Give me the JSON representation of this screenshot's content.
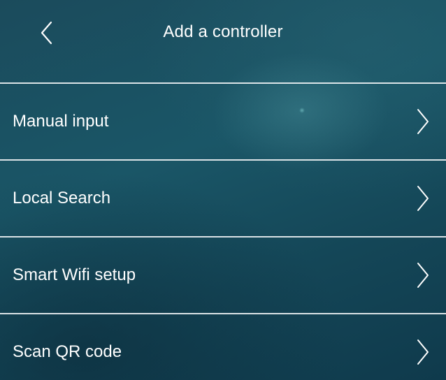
{
  "header": {
    "title": "Add a controller",
    "back_icon": "chevron-left-icon"
  },
  "menu": {
    "items": [
      {
        "label": "Manual input",
        "icon": "chevron-right-icon"
      },
      {
        "label": "Local Search",
        "icon": "chevron-right-icon"
      },
      {
        "label": "Smart Wifi setup",
        "icon": "chevron-right-icon"
      },
      {
        "label": "Scan QR code",
        "icon": "chevron-right-icon"
      }
    ]
  },
  "colors": {
    "background": "#1a5667",
    "text": "#ffffff",
    "divider": "#ebf0f2"
  }
}
